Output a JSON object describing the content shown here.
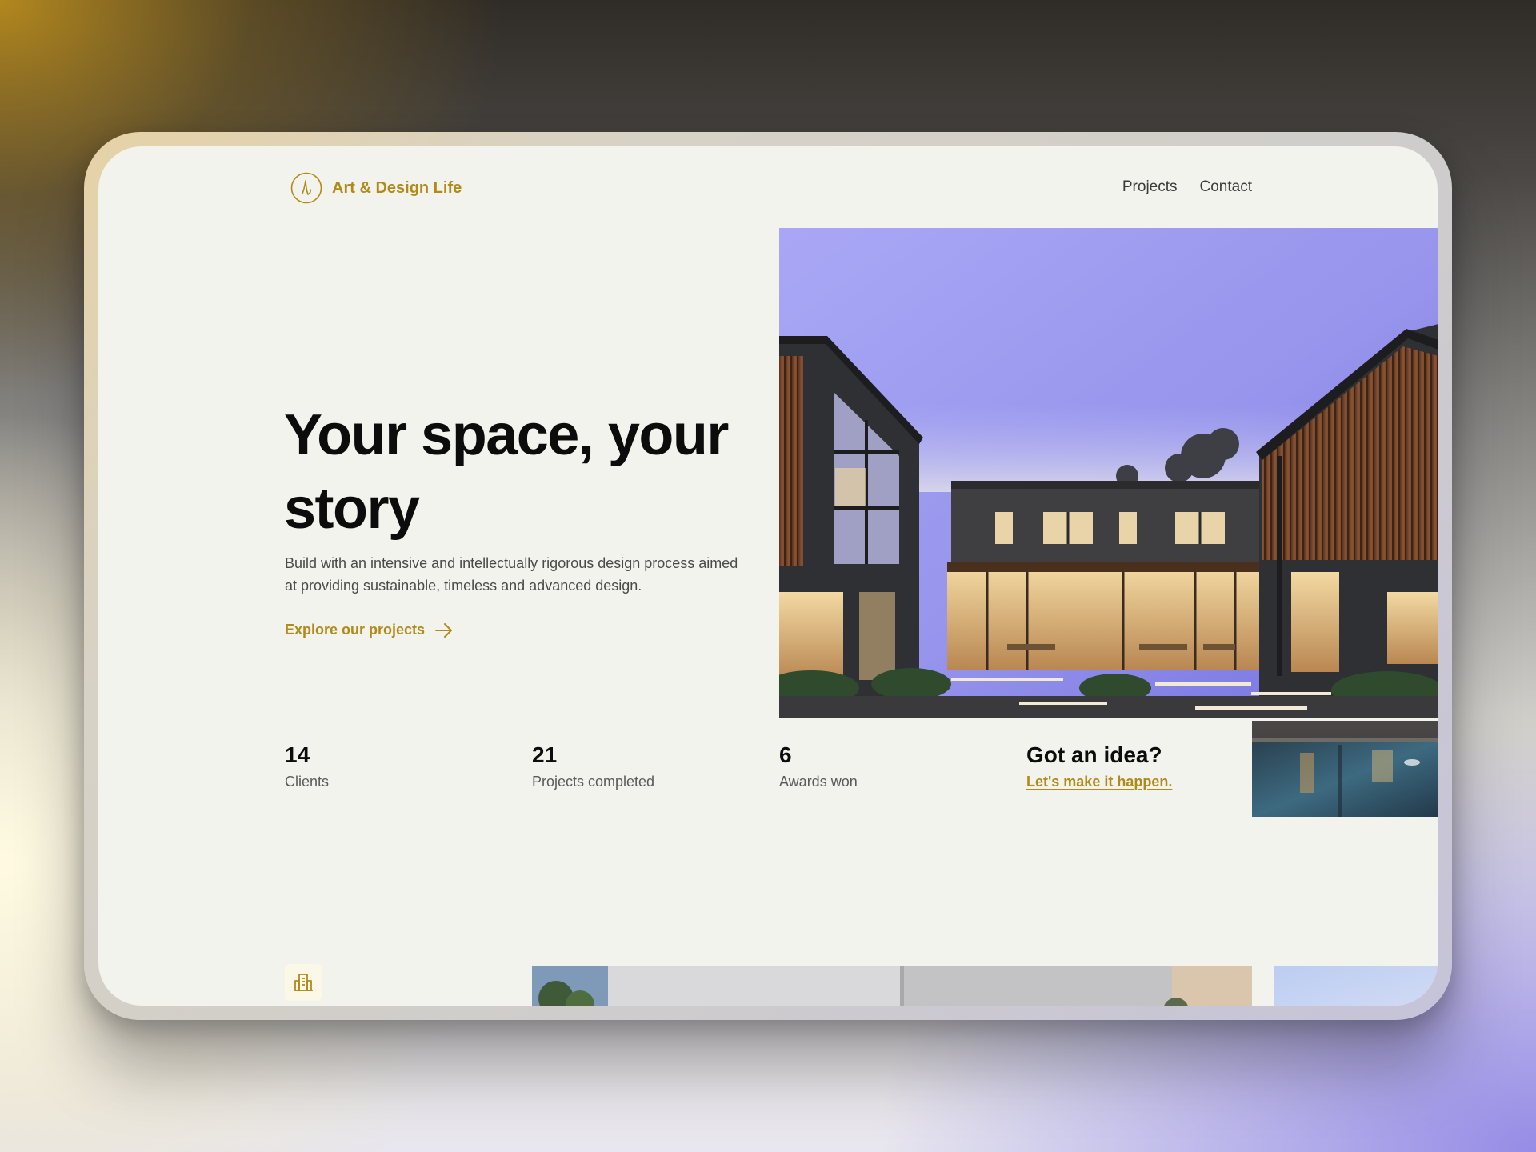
{
  "brand": {
    "name": "Art & Design Life",
    "accent_color": "#b28a17"
  },
  "nav": {
    "items": [
      {
        "label": "Projects"
      },
      {
        "label": "Contact"
      }
    ]
  },
  "hero": {
    "title": "Your space, your story",
    "description": "Build with an intensive and intellectually rigorous design process aimed at providing sustainable, timeless and advanced design.",
    "cta_label": "Explore our projects",
    "cta_icon": "arrow-right-icon"
  },
  "stats": [
    {
      "value": "14",
      "label": "Clients"
    },
    {
      "value": "21",
      "label": "Projects completed"
    },
    {
      "value": "6",
      "label": "Awards won"
    }
  ],
  "contact_callout": {
    "title": "Got an idea?",
    "link_label": "Let's make it happen."
  },
  "bottom": {
    "icon": "building-icon"
  },
  "images": {
    "hero": "modern-house-photo",
    "pool": "pool-photo"
  }
}
